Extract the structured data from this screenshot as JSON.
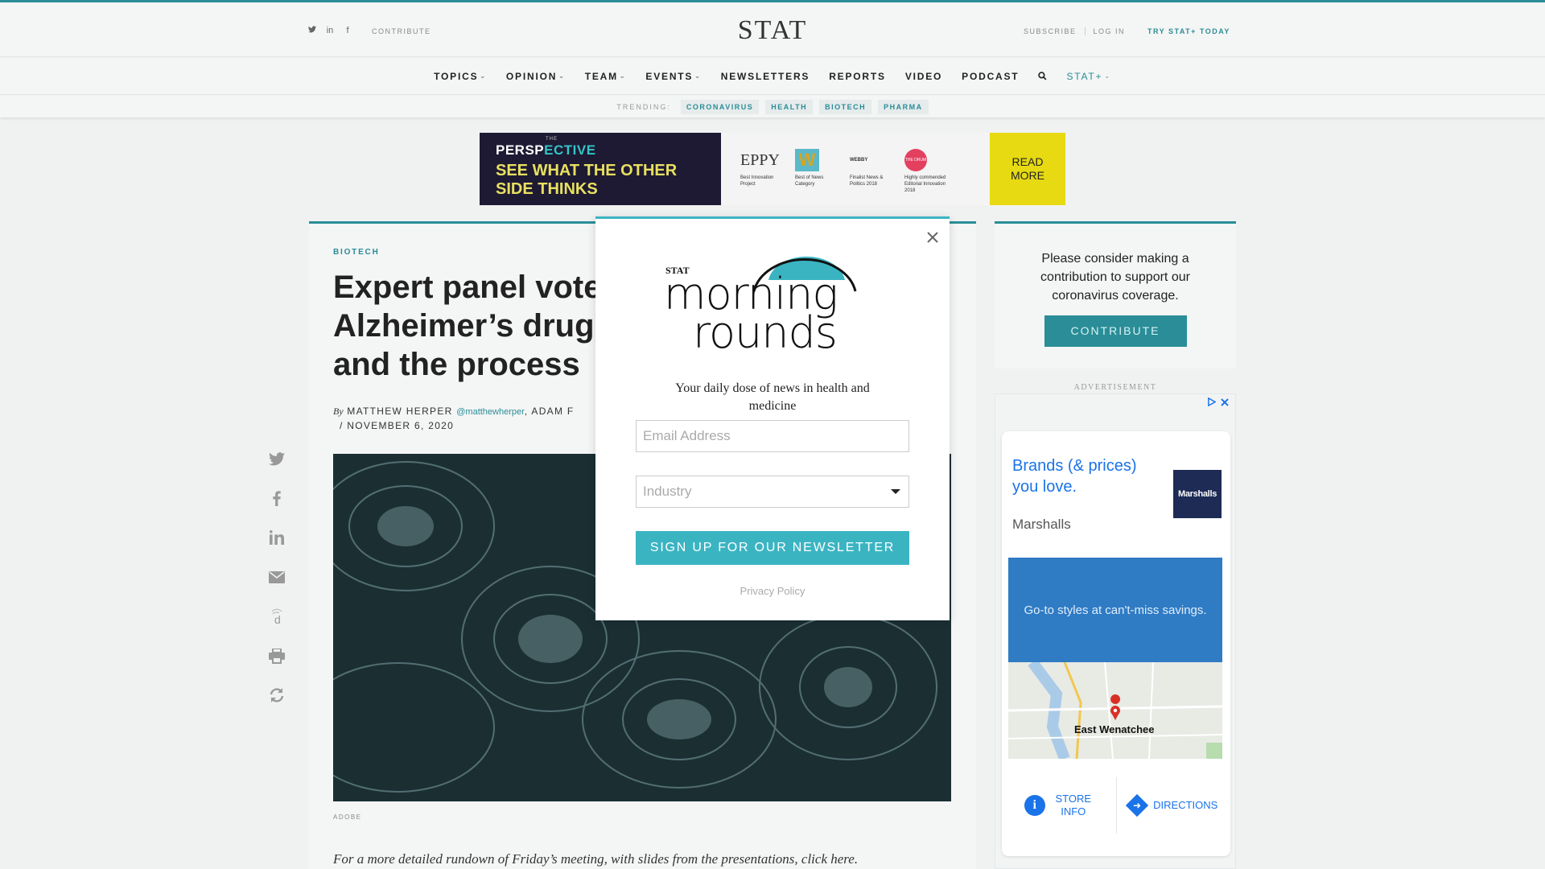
{
  "header": {
    "logo": "STAT",
    "contribute": "CONTRIBUTE",
    "subscribe": "SUBSCRIBE",
    "login": "LOG IN",
    "try_plus": "TRY STAT+ TODAY",
    "social": {
      "twitter": "𝕥",
      "linkedin": "in",
      "facebook": "f"
    }
  },
  "nav": {
    "items": [
      {
        "label": "TOPICS",
        "chevron": true
      },
      {
        "label": "OPINION",
        "chevron": true
      },
      {
        "label": "TEAM",
        "chevron": true
      },
      {
        "label": "EVENTS",
        "chevron": true
      },
      {
        "label": "NEWSLETTERS"
      },
      {
        "label": "REPORTS"
      },
      {
        "label": "VIDEO"
      },
      {
        "label": "PODCAST"
      }
    ],
    "stat_plus": "STAT+",
    "chevron": "⌄"
  },
  "trending": {
    "label": "TRENDING:",
    "tags": [
      "CORONAVIRUS",
      "HEALTH",
      "BIOTECH",
      "PHARMA"
    ]
  },
  "banner": {
    "the": "THE",
    "persp_a": "PERSP",
    "persp_b": "ECTIVE",
    "tagline_1": "SEE WHAT THE OTHER",
    "tagline_2": "SIDE THINKS",
    "awards": [
      {
        "name": "EPPY",
        "text": "Best Innovation Project"
      },
      {
        "name": "W",
        "text": "Best of News Category"
      },
      {
        "name": "WEBBY",
        "text": "Finalist News & Politics 2018"
      },
      {
        "name": "THE DRUM",
        "text": "Highly commended Editorial Innovation 2018"
      }
    ],
    "read_more_1": "READ",
    "read_more_2": "MORE"
  },
  "article": {
    "kicker": "BIOTECH",
    "headline": "Expert panel votes against Biogen’s Alzheimer’s drug, slamming the FDA and the process",
    "by": "By",
    "author1": "MATTHEW HERPER",
    "handle1": "@matthewherper",
    "author2": ", ADAM F",
    "date": "/  NOVEMBER 6, 2020",
    "credit": "ADOBE",
    "excerpt_text": "For a more detailed rundown of  Friday’s meeting, with slides from the presentations, click",
    "excerpt_link": " here",
    "excerpt_end": "."
  },
  "share": [
    "twitter-icon",
    "facebook-icon",
    "linkedin-icon",
    "email-icon",
    "disqus-icon",
    "print-icon",
    "reprint-icon"
  ],
  "sidebar": {
    "appeal": "Please consider making a contribution to support our coronavirus coverage.",
    "contribute_btn": "CONTRIBUTE",
    "ad_label": "ADVERTISEMENT"
  },
  "ad": {
    "headline": "Brands (& prices) you love.",
    "brand": "Marshalls",
    "logo_text": "Marshalls",
    "blurb": "Go-to styles at can't-miss savings.",
    "city": "East Wenatchee",
    "store_info": "STORE INFO",
    "directions": "DIRECTIONS"
  },
  "modal": {
    "stat": "STAT",
    "title_1": "morning",
    "title_2": "rounds",
    "tagline": "Your daily dose of news in health and medicine",
    "email_placeholder": "Email Address",
    "industry_placeholder": "Industry",
    "signup": "SIGN UP FOR OUR NEWSLETTER",
    "privacy": "Privacy Policy"
  },
  "colors": {
    "accent": "#2a8d97",
    "modal_accent": "#3bb4c2",
    "ad_blue": "#1a73e8"
  }
}
